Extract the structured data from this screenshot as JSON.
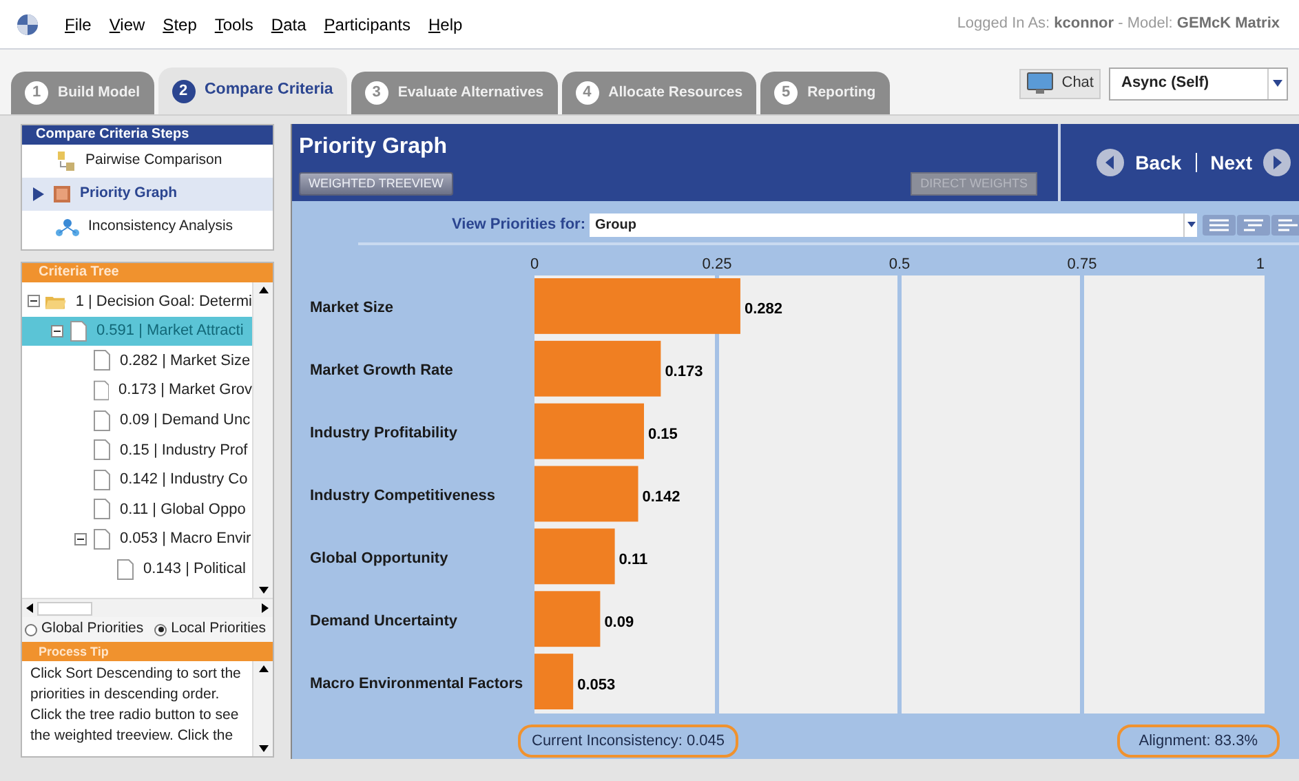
{
  "menu": [
    "File",
    "View",
    "Step",
    "Tools",
    "Data",
    "Participants",
    "Help"
  ],
  "login": "Logged In As: **kconnor** - Model: **GEMcK Matrix**",
  "tabs": [
    {
      "number": "1",
      "label": "Build Model",
      "selected": false
    },
    {
      "number": "2",
      "label": "Compare Criteria",
      "selected": true
    },
    {
      "number": "3",
      "label": "Evaluate Alternatives",
      "selected": false
    },
    {
      "number": "4",
      "label": "Allocate Resources",
      "selected": false
    },
    {
      "number": "5",
      "label": "Reporting",
      "selected": false
    }
  ],
  "chat": "Chat",
  "session_select": "Async (Self)",
  "steps": {
    "title": "Compare Criteria Steps",
    "items": [
      {
        "kind": "pairwise",
        "label": "Pairwise Comparison",
        "selected": false
      },
      {
        "kind": "graph",
        "label": "Priority Graph",
        "selected": true
      },
      {
        "kind": "inconsistency",
        "label": "Inconsistency Analysis",
        "selected": false
      }
    ]
  },
  "criteria_tree": {
    "title": "Criteria Tree",
    "nodes": [
      {
        "kind": "folder",
        "label": "1 | Decision Goal: Determi",
        "selected": false,
        "expanded": true,
        "children": [
          {
            "kind": "doc",
            "label": "0.591 | Market Attracti",
            "selected": true,
            "expanded": true,
            "children": [
              {
                "kind": "doc",
                "label": "0.282 | Market Size",
                "selected": false
              },
              {
                "kind": "doc",
                "label": "0.173 | Market Grov",
                "selected": false
              },
              {
                "kind": "doc",
                "label": "0.09 | Demand Unc",
                "selected": false
              },
              {
                "kind": "doc",
                "label": "0.15 | Industry Prof",
                "selected": false
              },
              {
                "kind": "doc",
                "label": "0.142 | Industry Co",
                "selected": false
              },
              {
                "kind": "doc",
                "label": "0.11 | Global Oppo",
                "selected": false
              },
              {
                "kind": "doc",
                "label": "0.053 | Macro Envir",
                "selected": false,
                "expanded": true,
                "children": [
                  {
                    "kind": "doc",
                    "label": "0.143 | Political",
                    "selected": false
                  }
                ]
              }
            ]
          }
        ]
      }
    ]
  },
  "priority_options": [
    {
      "label": "Global Priorities",
      "selected": false
    },
    {
      "label": "Local Priorities",
      "selected": true
    }
  ],
  "process_tip": {
    "title": "Process Tip",
    "text": "Click Sort Descending to sort the priorities in descending order. Click the tree radio button to see the weighted treeview.  Click the"
  },
  "panel": {
    "title": "Priority Graph",
    "buttons": [
      {
        "label": "WEIGHTED TREEVIEW",
        "disabled": false
      },
      {
        "label": "DIRECT WEIGHTS",
        "disabled": true
      }
    ],
    "back": "Back",
    "next": "Next",
    "view_for_label": "View Priorities for:",
    "view_for_value": "Group",
    "chart_data": {
      "type": "bar",
      "orientation": "horizontal",
      "categories": [
        "Market Size",
        "Market Growth Rate",
        "Industry Profitability",
        "Industry Competitiveness",
        "Global Opportunity",
        "Demand Uncertainty",
        "Macro Environmental Factors"
      ],
      "grid": true,
      "series": [
        {
          "color": "#f07f22",
          "values": [
            0.282,
            0.173,
            0.15,
            0.142,
            0.11,
            0.09,
            0.053
          ]
        }
      ],
      "xlim": [
        0,
        1
      ],
      "xticks": [
        0,
        0.25,
        {
          "value": 0.5,
          "label": "0.5"
        },
        0.75,
        1
      ],
      "data_labels": true
    },
    "inconsistency": "Current Inconsistency: 0.045",
    "alignment": "Alignment: 83.3%"
  }
}
